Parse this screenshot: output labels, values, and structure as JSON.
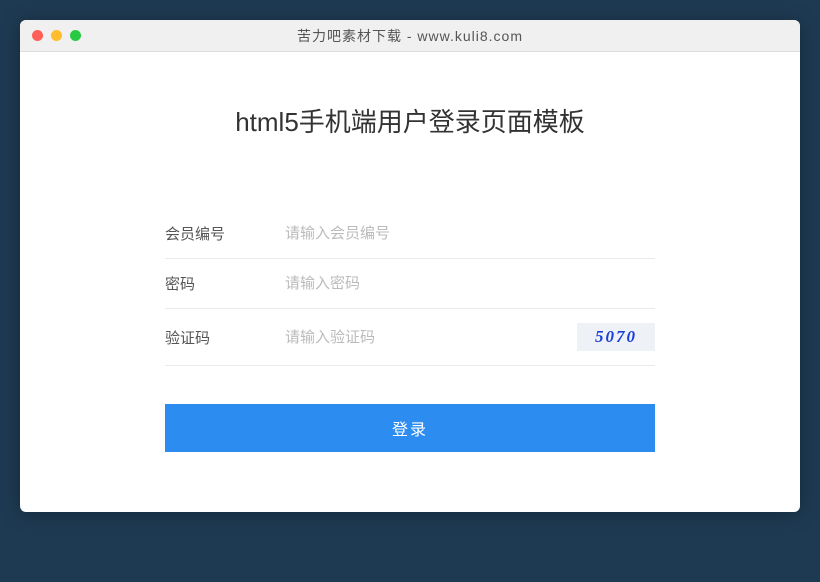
{
  "window": {
    "title": "苦力吧素材下载 - www.kuli8.com"
  },
  "page": {
    "heading": "html5手机端用户登录页面模板"
  },
  "form": {
    "member_id": {
      "label": "会员编号",
      "placeholder": "请输入会员编号",
      "value": ""
    },
    "password": {
      "label": "密码",
      "placeholder": "请输入密码",
      "value": ""
    },
    "captcha": {
      "label": "验证码",
      "placeholder": "请输入验证码",
      "value": "",
      "image_text": "5070"
    },
    "submit_label": "登录"
  }
}
